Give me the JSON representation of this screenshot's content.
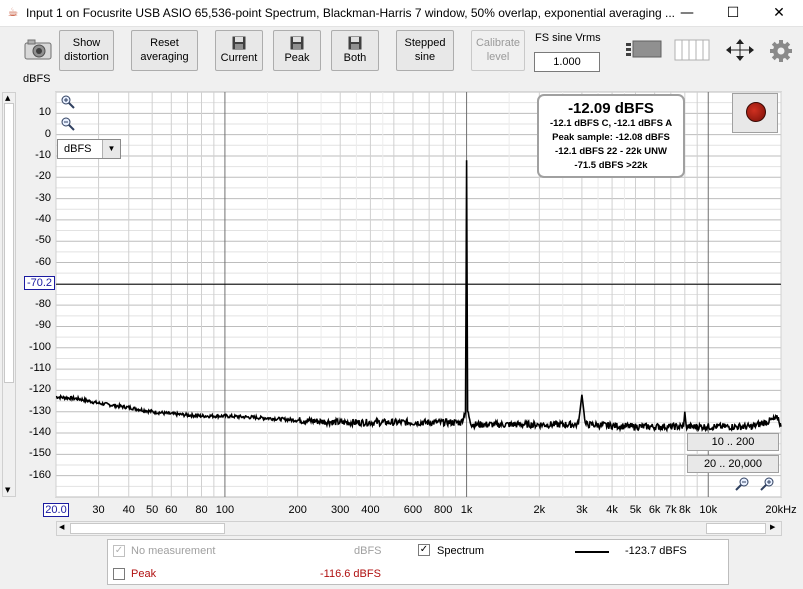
{
  "window": {
    "title": "Input 1 on Focusrite USB ASIO 65,536-point Spectrum, Blackman-Harris 7 window, 50% overlap, exponential averaging ...",
    "minimize": "—",
    "maximize": "☐",
    "close": "✕"
  },
  "toolbar": {
    "show_distortion": "Show distortion",
    "reset_averaging": "Reset averaging",
    "current": "Current",
    "peak": "Peak",
    "both": "Both",
    "stepped_sine": "Stepped sine",
    "calibrate_level": "Calibrate level",
    "fs_sine_label": "FS sine Vrms",
    "fs_sine_value": "1.000"
  },
  "plot": {
    "y_unit": "dBFS",
    "y_marker": "-70.2",
    "x_marker": "20.0",
    "unit_select": "dBFS"
  },
  "readout": {
    "main": "-12.09 dBFS",
    "line1": "-12.1 dBFS C, -12.1 dBFS A",
    "line2": "Peak sample: -12.08 dBFS",
    "line3": "-12.1 dBFS 22 - 22k UNW",
    "line4": "-71.5 dBFS >22k"
  },
  "range_buttons": {
    "y_range": "10 .. 200",
    "x_range": "20 .. 20,000"
  },
  "legend": {
    "no_measurement": "No measurement",
    "no_measurement_unit": "dBFS",
    "spectrum": "Spectrum",
    "spectrum_value": "-123.7 dBFS",
    "peak": "Peak",
    "peak_value": "-116.6 dBFS"
  },
  "chart_data": {
    "type": "line",
    "xlabel": "",
    "ylabel": "dBFS",
    "x_scale": "log",
    "xlim": [
      20,
      20000
    ],
    "ylim": [
      -170,
      20
    ],
    "y_ticks": [
      "10",
      "0",
      "-10",
      "-20",
      "-30",
      "-40",
      "-50",
      "-60",
      "-70",
      "-80",
      "-90",
      "-100",
      "-110",
      "-120",
      "-130",
      "-140",
      "-150",
      "-160"
    ],
    "x_ticks": [
      "30",
      "40",
      "50",
      "60",
      "80",
      "100",
      "200",
      "300",
      "400",
      "600",
      "800",
      "1k",
      "2k",
      "3k",
      "4k",
      "5k",
      "6k",
      "7k",
      "8k",
      "10k",
      "20kHz"
    ],
    "series": [
      {
        "name": "Spectrum",
        "color": "#000000",
        "x": [
          20,
          25,
          30,
          40,
          50,
          60,
          80,
          100,
          150,
          200,
          300,
          400,
          600,
          800,
          950,
          990,
          1000,
          1010,
          1050,
          1200,
          2000,
          2900,
          3000,
          3100,
          5000,
          7900,
          8000,
          8100,
          10000,
          15000,
          19500,
          20000
        ],
        "y": [
          -123,
          -124,
          -126,
          -128,
          -130,
          -131,
          -132,
          -132,
          -133,
          -134,
          -135,
          -135,
          -135,
          -135,
          -135,
          -130,
          -12,
          -130,
          -136,
          -136,
          -136,
          -136,
          -122,
          -136,
          -137,
          -137,
          -130,
          -137,
          -137,
          -137,
          -133,
          -137
        ]
      }
    ]
  }
}
